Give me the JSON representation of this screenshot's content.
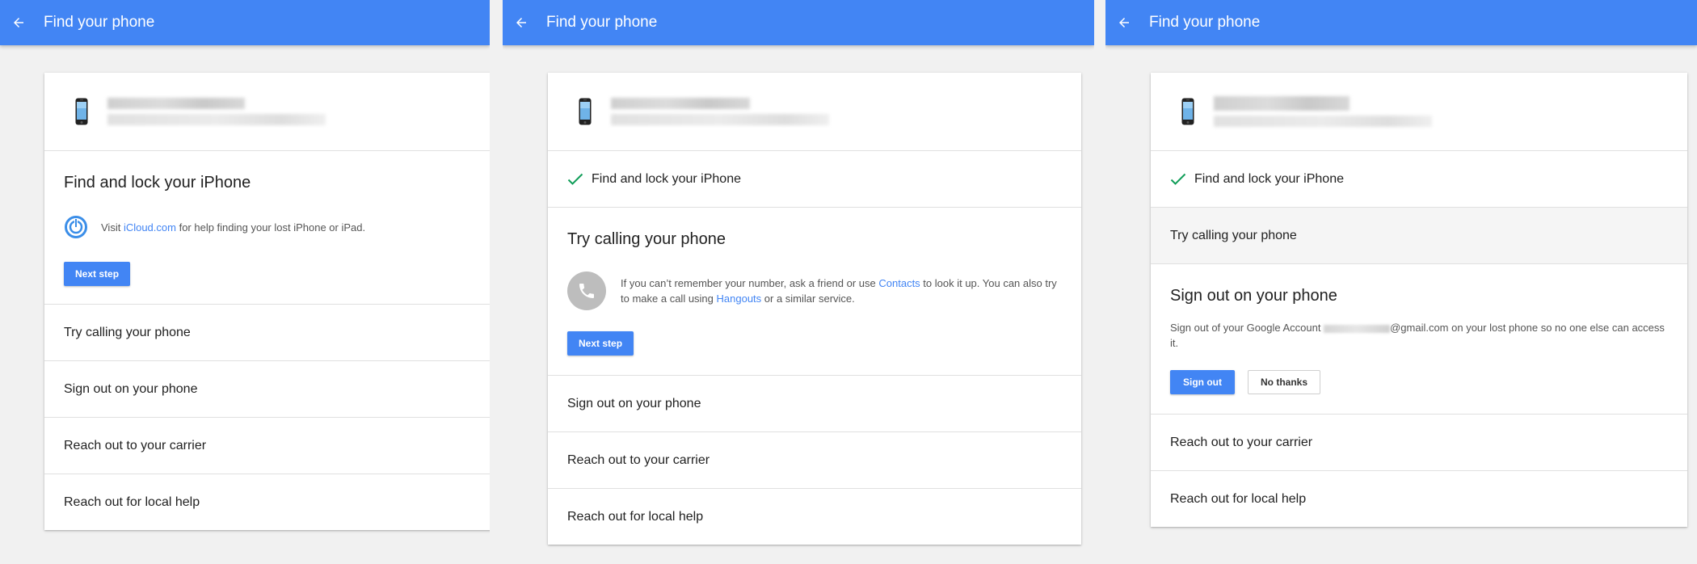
{
  "app": {
    "title": "Find your phone"
  },
  "colors": {
    "appbar": "#4285f4",
    "accent": "#4285f4",
    "check": "#0f9d58"
  },
  "steps": {
    "find_lock": "Find and lock your iPhone",
    "try_calling": "Try calling your phone",
    "sign_out": "Sign out on your phone",
    "carrier": "Reach out to your carrier",
    "local_help": "Reach out for local help"
  },
  "panel1": {
    "visit_prefix": "Visit ",
    "icloud_link": "iCloud.com",
    "visit_suffix": " for help finding your lost iPhone or iPad.",
    "next_step": "Next step"
  },
  "panel2": {
    "call_text_1": "If you can’t remember your number, ask a friend or use ",
    "contacts_link": "Contacts",
    "call_text_2": " to look it up. You can also try to make a call using ",
    "hangouts_link": "Hangouts",
    "call_text_3": " or a similar service.",
    "next_step": "Next step"
  },
  "panel3": {
    "signout_text_1": "Sign out of your Google Account ",
    "signout_email_domain": "@gmail.com",
    "signout_text_2": " on your lost phone so no one else can access it.",
    "sign_out_button": "Sign out",
    "no_thanks_button": "No thanks"
  },
  "icons": {
    "back": "arrow-back-icon",
    "phone": "iphone-icon",
    "check": "checkmark-icon",
    "icloud": "find-my-iphone-icon",
    "call": "phone-handset-icon"
  }
}
